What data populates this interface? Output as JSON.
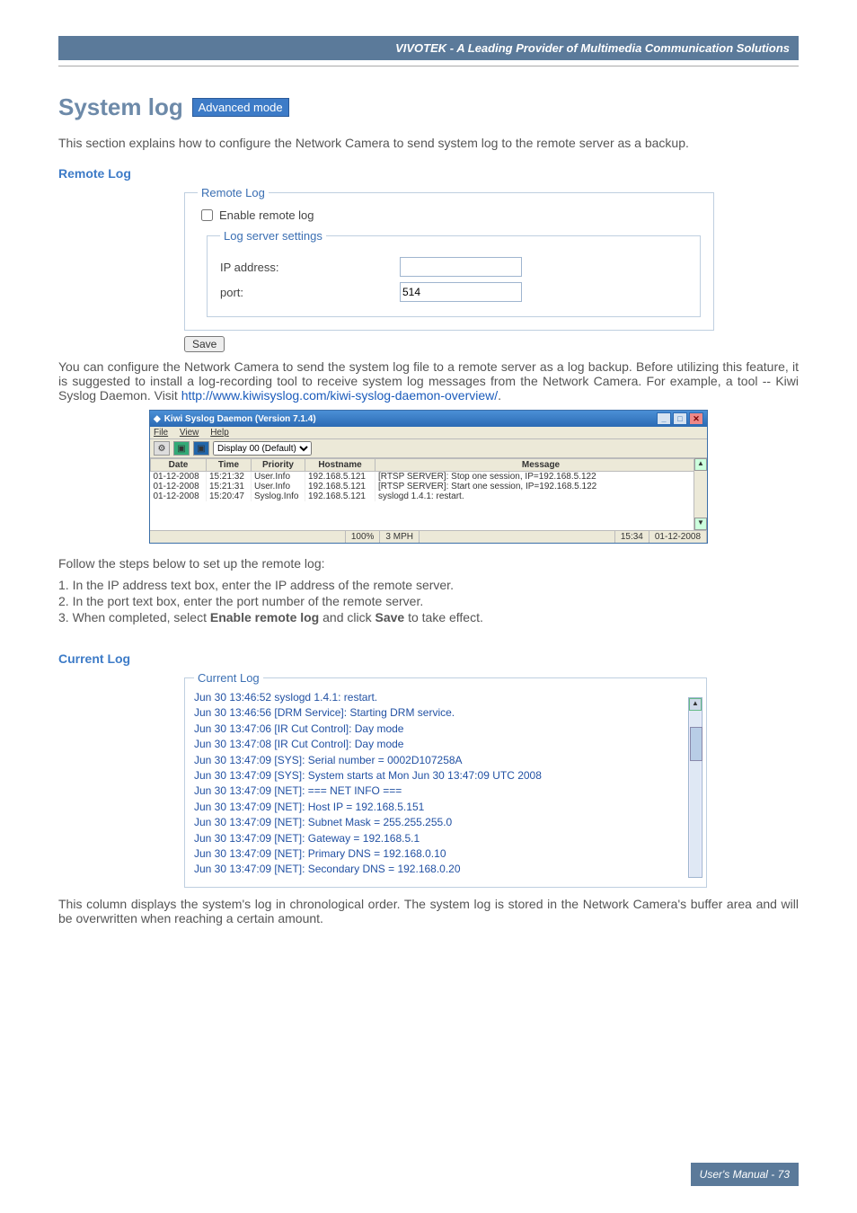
{
  "header": {
    "brand": "VIVOTEK - A Leading Provider of Multimedia Communication Solutions"
  },
  "title": {
    "text": "System log",
    "badge": "Advanced mode"
  },
  "intro": "This section explains how to configure the Network Camera to send system log to the remote server as a backup.",
  "remoteLog": {
    "heading": "Remote Log",
    "legend": "Remote Log",
    "enableLabel": "Enable remote log",
    "logServerLegend": "Log server settings",
    "ipLabel": "IP address:",
    "ipValue": "",
    "portLabel": "port:",
    "portValue": "514",
    "saveLabel": "Save"
  },
  "config": {
    "beforeLink": "You can configure the Network Camera to send the system log file to a remote server as a log backup. Before utilizing this feature, it is suggested to install a log-recording tool to receive system log messages from the Network Camera. For example, a tool -- Kiwi Syslog Daemon. Visit ",
    "link": "http://www.kiwisyslog.com/kiwi-syslog-daemon-overview/",
    "afterLink": "."
  },
  "kiwi": {
    "title": "Kiwi Syslog Daemon (Version 7.1.4)",
    "menu": {
      "file": "File",
      "view": "View",
      "help": "Help"
    },
    "displaySel": "Display 00 (Default)",
    "columns": [
      "Date",
      "Time",
      "Priority",
      "Hostname",
      "Message"
    ],
    "rows": [
      {
        "date": "01-12-2008",
        "time": "15:21:32",
        "priority": "User.Info",
        "hostname": "192.168.5.121",
        "message": "[RTSP SERVER]: Stop one session, IP=192.168.5.122"
      },
      {
        "date": "01-12-2008",
        "time": "15:21:31",
        "priority": "User.Info",
        "hostname": "192.168.5.121",
        "message": "[RTSP SERVER]: Start one session, IP=192.168.5.122"
      },
      {
        "date": "01-12-2008",
        "time": "15:20:47",
        "priority": "Syslog.Info",
        "hostname": "192.168.5.121",
        "message": "syslogd 1.4.1: restart."
      }
    ],
    "status": {
      "pct": "100%",
      "mph": "3 MPH",
      "time": "15:34",
      "date": "01-12-2008"
    }
  },
  "steps": {
    "intro": "Follow the steps below to set up the remote log:",
    "s1": "1. In the IP address text box, enter the IP address of the remote server.",
    "s2": "2. In the port text box, enter the port number of the remote server.",
    "s3a": "3. When completed, select ",
    "s3b": "Enable remote log",
    "s3c": " and click ",
    "s3d": "Save",
    "s3e": " to take effect."
  },
  "currentLog": {
    "heading": "Current Log",
    "legend": "Current Log",
    "lines": [
      "Jun 30 13:46:52 syslogd 1.4.1: restart.",
      "Jun 30 13:46:56 [DRM Service]: Starting DRM service.",
      "Jun 30 13:47:06 [IR Cut Control]: Day mode",
      "Jun 30 13:47:08 [IR Cut Control]: Day mode",
      "Jun 30 13:47:09 [SYS]: Serial number = 0002D107258A",
      "Jun 30 13:47:09 [SYS]: System starts at Mon Jun 30 13:47:09 UTC 2008",
      "Jun 30 13:47:09 [NET]: === NET INFO ===",
      "Jun 30 13:47:09 [NET]: Host IP = 192.168.5.151",
      "Jun 30 13:47:09 [NET]: Subnet Mask = 255.255.255.0",
      "Jun 30 13:47:09 [NET]: Gateway = 192.168.5.1",
      "Jun 30 13:47:09 [NET]: Primary DNS = 192.168.0.10",
      "Jun 30 13:47:09 [NET]: Secondary DNS = 192.168.0.20"
    ]
  },
  "currentLogDesc": "This column displays the system's log in chronological order. The system log is stored in the Network Camera's buffer area and will be overwritten when reaching a certain amount.",
  "footer": {
    "text": "User's Manual - 73"
  }
}
